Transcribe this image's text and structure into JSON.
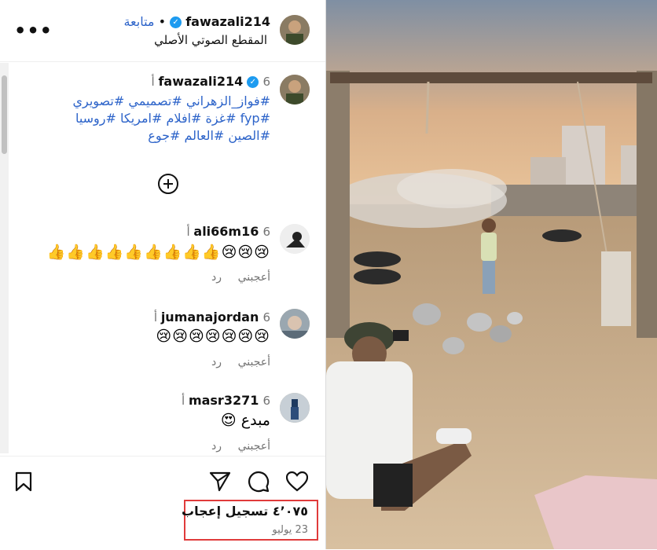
{
  "header": {
    "username": "fawazali214",
    "follow_label": "متابعة",
    "separator": "•",
    "audio_label": "المقطع الصوتي الأصلي"
  },
  "post": {
    "username": "fawazali214",
    "time": "6 أ",
    "hashtag_lines": [
      "#فواز_الزهراني #تصميمي #تصويري",
      "#fyp #غزة #افلام #امريكا #روسيا",
      "#الصين #العالم #جوع"
    ],
    "add_icon": "plus-circle-icon"
  },
  "comments": [
    {
      "username": "ali66m16",
      "time": "6 أ",
      "text": "😢😢😢👍👍👍👍👍👍👍👍👍",
      "like_label": "أعجبني",
      "reply_label": "رد"
    },
    {
      "username": "jumanajordan",
      "time": "6 أ",
      "text": "😢😢😢😢😢😢😢",
      "like_label": "أعجبني",
      "reply_label": "رد"
    },
    {
      "username": "masr3271",
      "time": "6 أ",
      "text": "مبدع 😍",
      "like_label": "أعجبني",
      "reply_label": "رد"
    }
  ],
  "actions": {
    "like_icon": "heart-icon",
    "comment_icon": "comment-icon",
    "share_icon": "paper-plane-icon",
    "save_icon": "bookmark-icon"
  },
  "stats": {
    "likes": "٤٬٠٧٥ تسجيل إعجاب",
    "date": "23 يوليو"
  },
  "colors": {
    "link": "#2c63c9",
    "verified": "#1d9bf0",
    "highlight": "#e03b3b"
  }
}
